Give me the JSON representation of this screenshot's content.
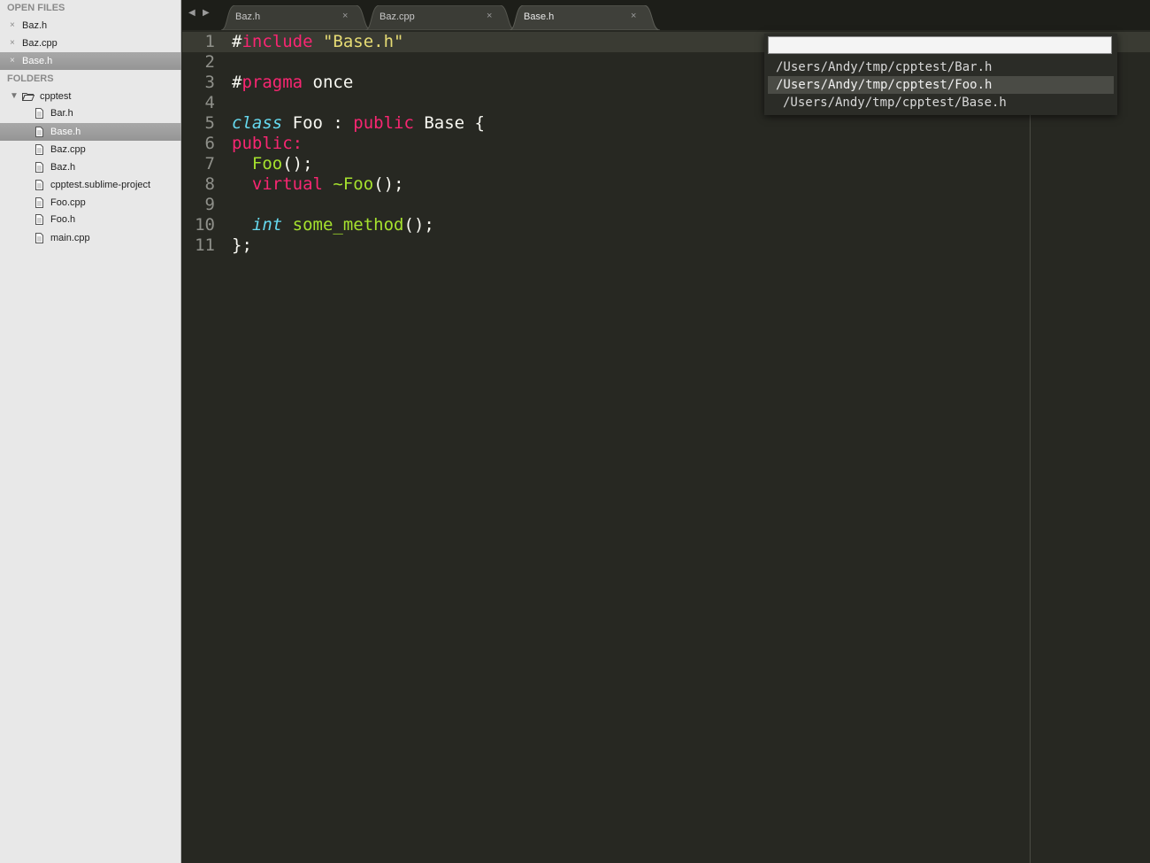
{
  "sidebar": {
    "open_files_header": "OPEN FILES",
    "open_files": [
      {
        "label": "Baz.h",
        "active": false
      },
      {
        "label": "Baz.cpp",
        "active": false
      },
      {
        "label": "Base.h",
        "active": true
      }
    ],
    "close_glyph": "×",
    "folders_header": "FOLDERS",
    "folder": {
      "label": "cpptest",
      "expanded": true,
      "toggle_glyph": "▼"
    },
    "files": [
      {
        "label": "Bar.h",
        "active": false
      },
      {
        "label": "Base.h",
        "active": true
      },
      {
        "label": "Baz.cpp",
        "active": false
      },
      {
        "label": "Baz.h",
        "active": false
      },
      {
        "label": "cpptest.sublime-project",
        "active": false
      },
      {
        "label": "Foo.cpp",
        "active": false
      },
      {
        "label": "Foo.h",
        "active": false
      },
      {
        "label": "main.cpp",
        "active": false
      }
    ]
  },
  "tabbar": {
    "back_glyph": "◀",
    "forward_glyph": "▶",
    "tabs": [
      {
        "label": "Baz.h",
        "close": "×",
        "active": false
      },
      {
        "label": "Baz.cpp",
        "close": "×",
        "active": false
      },
      {
        "label": "Base.h",
        "close": "×",
        "active": true
      }
    ]
  },
  "editor": {
    "line_numbers": [
      "1",
      "2",
      "3",
      "4",
      "5",
      "6",
      "7",
      "8",
      "9",
      "10",
      "11"
    ],
    "tokens": {
      "l1_hash": "#",
      "l1_kw": "include",
      "l1_sp": " ",
      "l1_str": "\"Base.h\"",
      "l3_hash": "#",
      "l3_kw": "pragma",
      "l3_rest": " once",
      "l5_ty": "class",
      "l5_a": " Foo : ",
      "l5_kw": "public",
      "l5_b": " Base {",
      "l6_kw": "public:",
      "l7_indent": "  ",
      "l7_fn": "Foo",
      "l7_rest": "();",
      "l8_indent": "  ",
      "l8_kw": "virtual",
      "l8_sp": " ",
      "l8_fn": "~Foo",
      "l8_rest": "();",
      "l10_indent": "  ",
      "l10_ty": "int",
      "l10_sp": " ",
      "l10_fn": "some_method",
      "l10_rest": "();",
      "l11": "};"
    }
  },
  "popup": {
    "input_value": "",
    "items": [
      {
        "path": "/Users/Andy/tmp/cpptest/Bar.h",
        "selected": false
      },
      {
        "path": "/Users/Andy/tmp/cpptest/Foo.h",
        "selected": true
      },
      {
        "path": "/Users/Andy/tmp/cpptest/Base.h",
        "selected": false
      }
    ]
  },
  "colors": {
    "editor_bg": "#272822",
    "keyword": "#f92672",
    "string": "#e6db74",
    "type": "#66d9ef",
    "function": "#a6e22e",
    "text": "#f8f8f2",
    "gutter": "#8f908a",
    "sidebar_bg": "#e8e8e8"
  }
}
